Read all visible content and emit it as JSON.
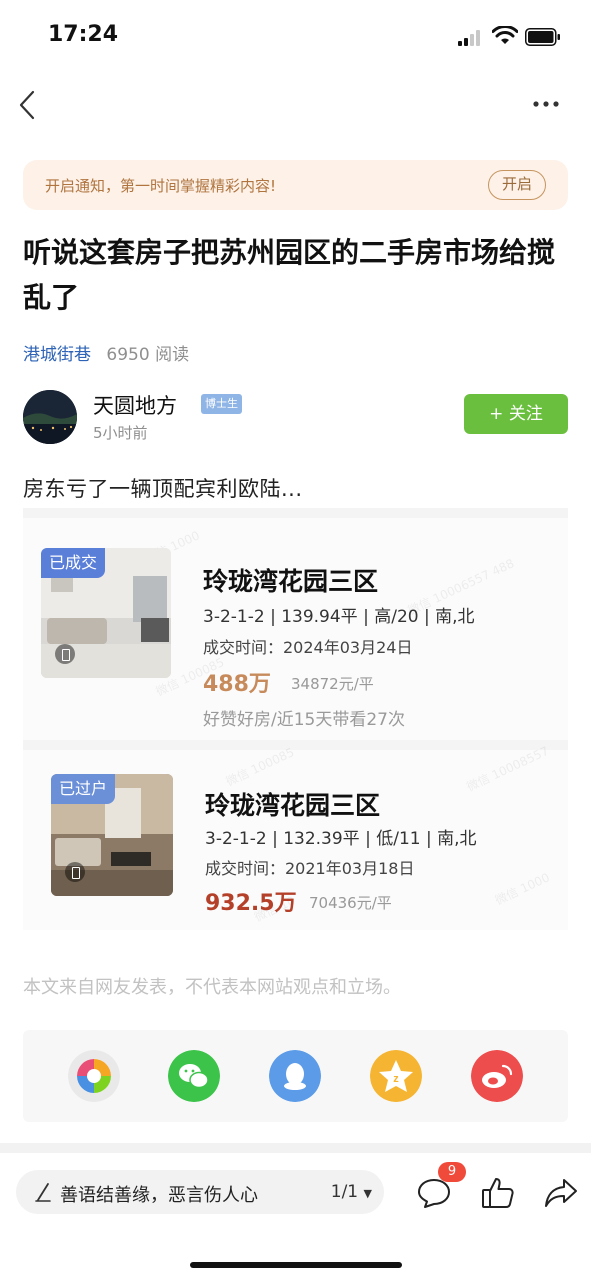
{
  "status_bar": {
    "time": "17:24"
  },
  "notice": {
    "text": "开启通知，第一时间掌握精彩内容!",
    "button": "开启"
  },
  "article": {
    "title": "听说这套房子把苏州园区的二手房市场给搅乱了",
    "source": "港城街巷",
    "reads": "6950 阅读",
    "author_name": "天圆地方",
    "author_badge": "博士生",
    "time_ago": "5小时前",
    "follow_label": "+ 关注",
    "intro": "房东亏了一辆顶配宾利欧陆..."
  },
  "listings": [
    {
      "tag": "已成交",
      "name": "玲珑湾花园三区",
      "spec": "3-2-1-2 | 139.94平 | 高/20 | 南,北",
      "date": "成交时间：2024年03月24日",
      "price": "488万",
      "unit_price": "34872元/平",
      "tags": "好赞好房/近15天带看27次"
    },
    {
      "tag": "已过户",
      "name": "玲珑湾花园三区",
      "spec": "3-2-1-2 | 132.39平 | 低/11 | 南,北",
      "date": "成交时间：2021年03月18日",
      "price": "932.5万",
      "unit_price": "70436元/平"
    }
  ],
  "disclaimer": "本文来自网友发表，不代表本网站观点和立场。",
  "share_targets": [
    "moments-icon",
    "wechat-icon",
    "qq-icon",
    "qzone-icon",
    "weibo-icon"
  ],
  "bottom_bar": {
    "comment_placeholder": "善语结善缘，恶言伤人心",
    "page_indicator": "1/1",
    "comment_count": "9"
  },
  "colors": {
    "follow": "#6bbf3f",
    "link": "#2e63b5",
    "price": "#b5402a",
    "badge": "#f04a3a"
  }
}
